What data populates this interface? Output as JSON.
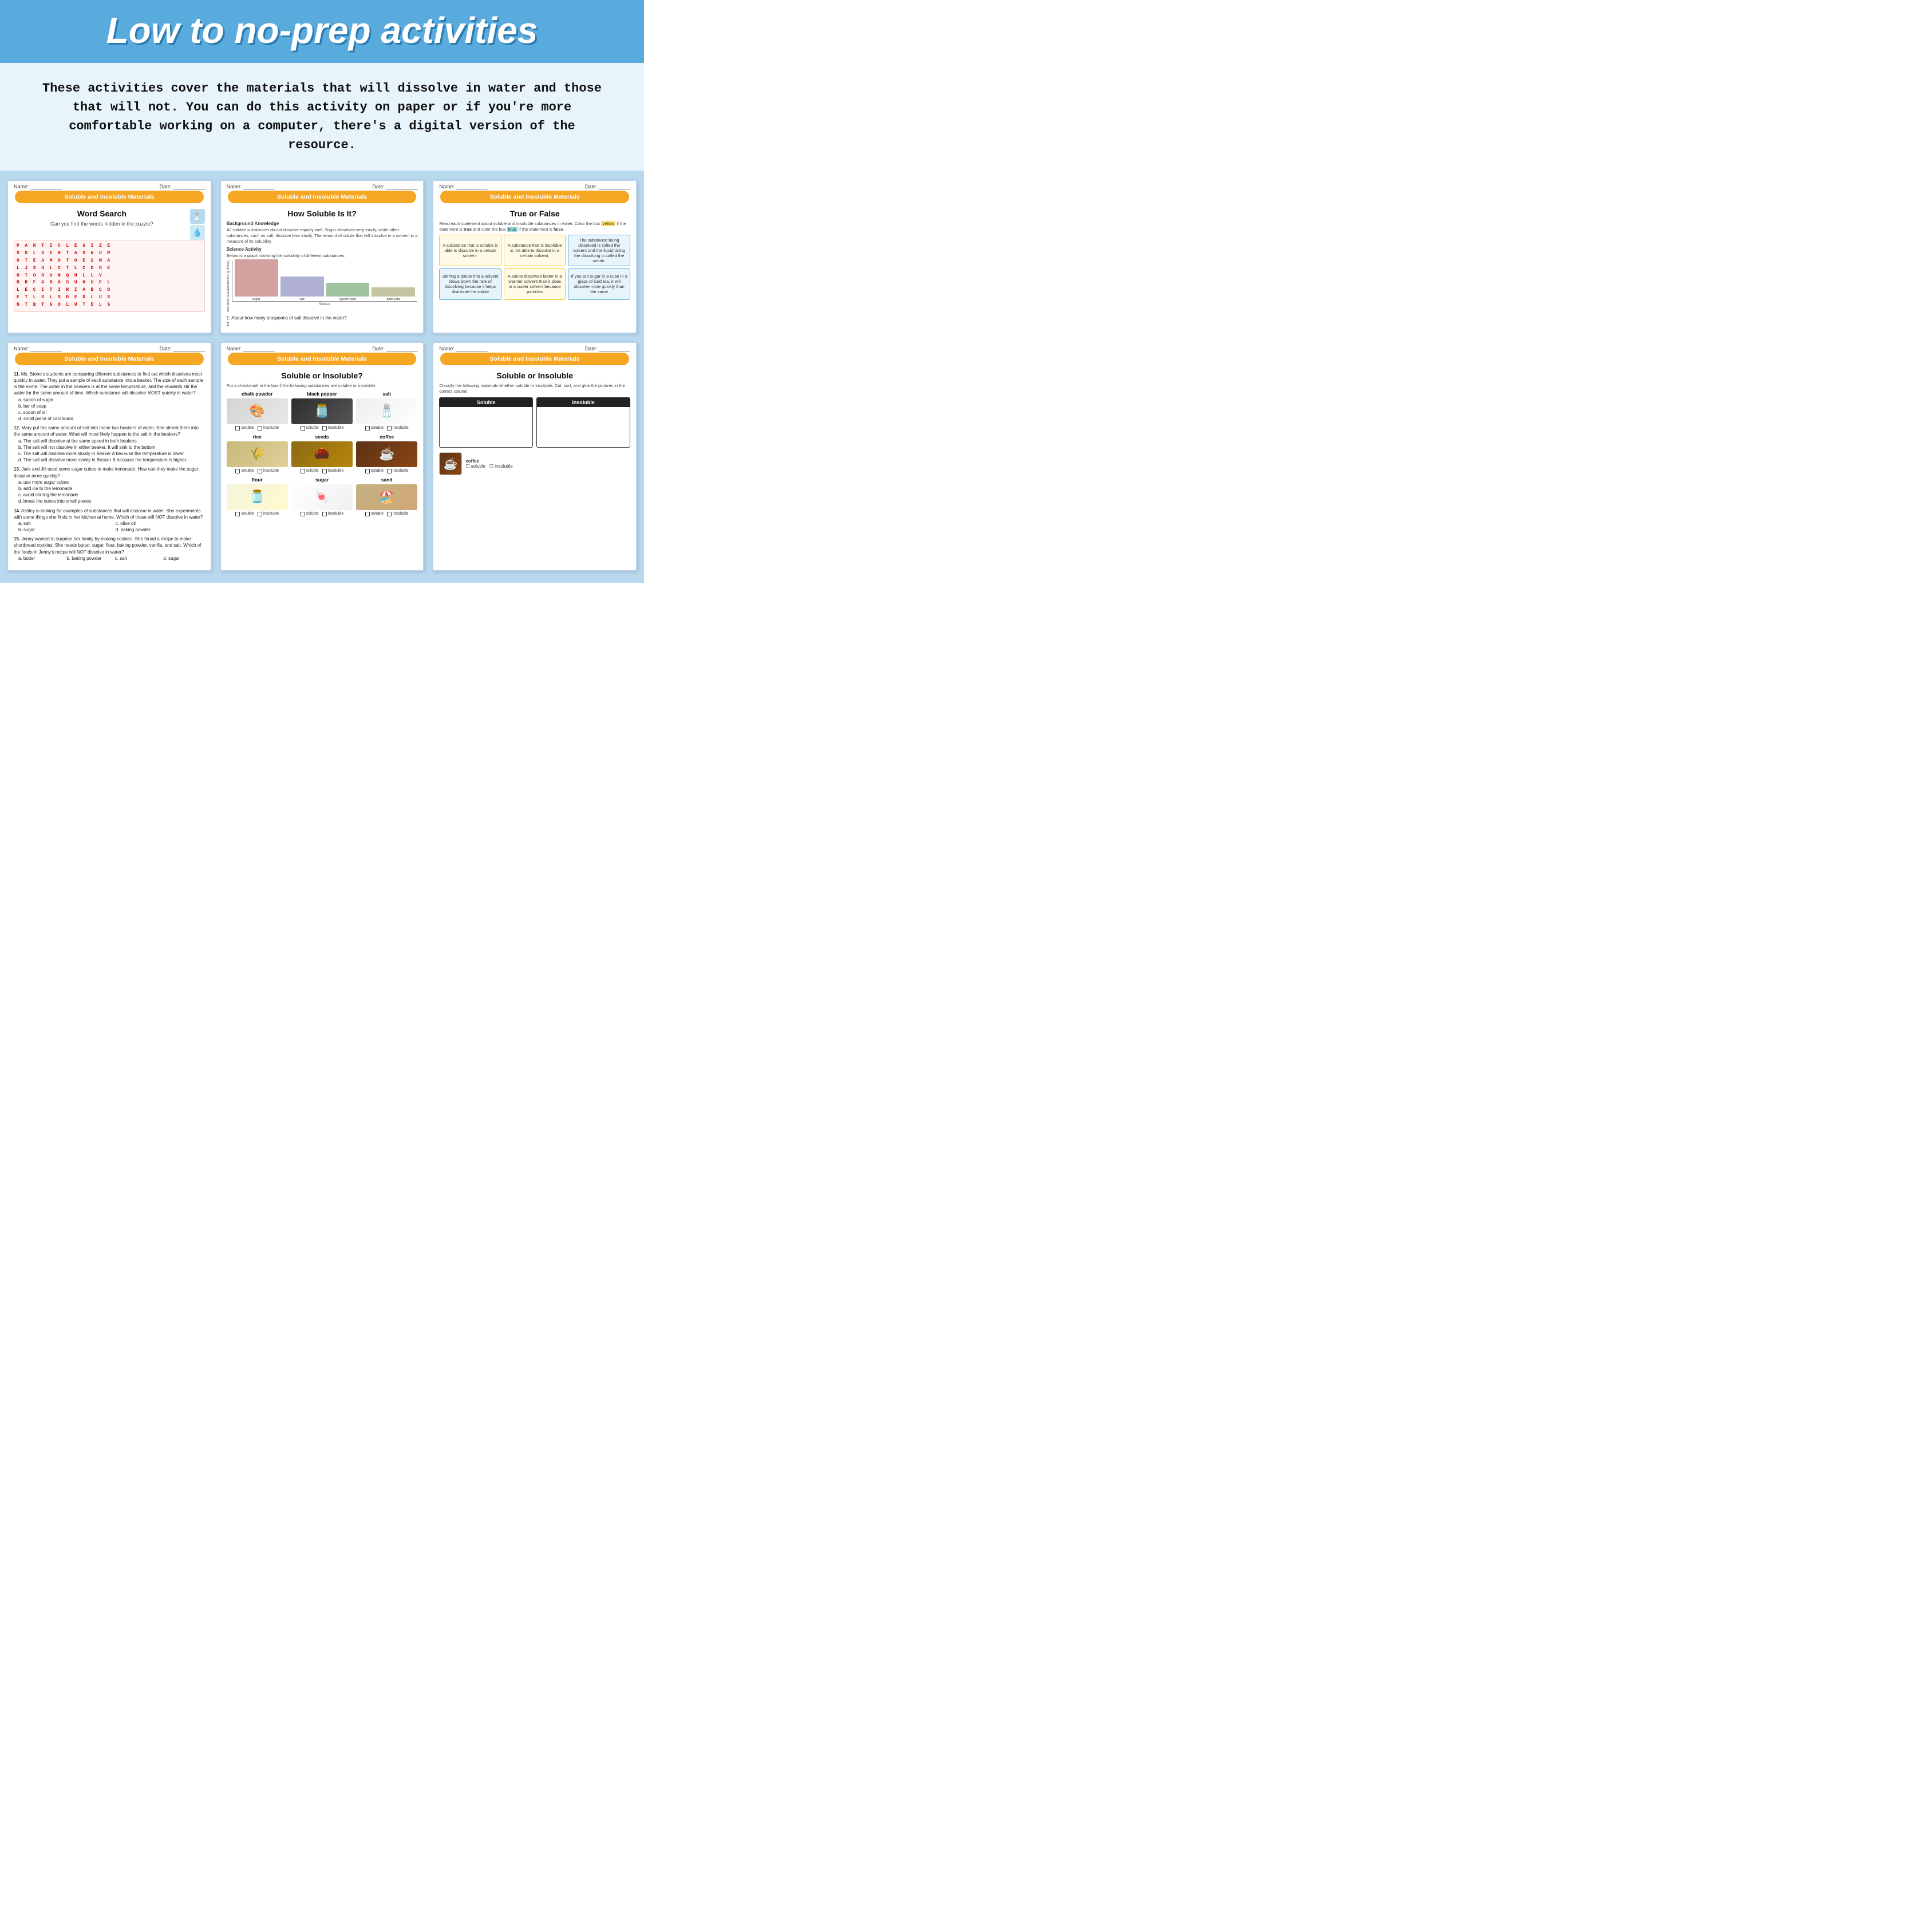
{
  "header": {
    "title": "Low to no-prep activities",
    "bg_color": "#5aabdd"
  },
  "description": {
    "text": "These activities cover the materials that will dissolve in water and those that will not. You can do this activity on paper or if you're more comfortable working on a computer, there's a digital version of the resource."
  },
  "badge_label": "Soluble and Insoluble Materials",
  "cards": [
    {
      "id": "word-search",
      "meta_name": "Name: ___________",
      "meta_date": "Date: ___________",
      "title": "Word Search",
      "subtitle": "Can you find the words hidden in the puzzle?",
      "letters": [
        [
          "P",
          "A",
          "R",
          "T",
          "I",
          "C",
          "L",
          "E",
          "S",
          "I",
          "Z",
          "E",
          "",
          "",
          "",
          ""
        ],
        [
          "S",
          "O",
          "L",
          "V",
          "E",
          "N",
          "T",
          "A",
          "S",
          "N",
          "U",
          "R",
          "",
          "",
          "",
          ""
        ],
        [
          "O",
          "T",
          "E",
          "A",
          "M",
          "O",
          "T",
          "O",
          "E",
          "S",
          "M",
          "A",
          "",
          "",
          "",
          ""
        ],
        [
          "L",
          "J",
          "S",
          "U",
          "L",
          "C",
          "T",
          "L",
          "C",
          "D",
          "O",
          "E",
          "",
          "",
          "",
          ""
        ],
        [
          "U",
          "T",
          "O",
          "R",
          "U",
          "N",
          "Q",
          "H",
          "L",
          "L",
          "V",
          "",
          "",
          "",
          "",
          ""
        ],
        [
          "B",
          "R",
          "F",
          "A",
          "B",
          "A",
          "S",
          "U",
          "H",
          "U",
          "E",
          "L",
          "",
          "",
          "",
          ""
        ],
        [
          "L",
          "E",
          "C",
          "I",
          "T",
          "I",
          "R",
          "I",
          "A",
          "B",
          "C",
          "O",
          "",
          "",
          "",
          ""
        ],
        [
          "E",
          "T",
          "L",
          "S",
          "L",
          "S",
          "D",
          "E",
          "D",
          "L",
          "U",
          "S",
          "",
          "",
          "",
          ""
        ],
        [
          "N",
          "T",
          "B",
          "T",
          "S",
          "O",
          "L",
          "U",
          "T",
          "E",
          "L",
          "S",
          "",
          "",
          "",
          ""
        ]
      ],
      "corner_icons": [
        "🧂",
        "💧"
      ]
    },
    {
      "id": "how-soluble",
      "meta_name": "Name: ___________",
      "meta_date": "Date: ___________",
      "title": "How Soluble Is It?",
      "bg_label": "Background Knowledge",
      "bg_text": "All soluble substances do not dissolve equally well. Sugar dissolves very easily, while other substances, such as salt, dissolve less easily. The amount of solute that will dissolve in a solvent is a measure of its solubility.",
      "science_label": "Science Activity",
      "science_text": "Below is a graph showing the solubility of different substances.",
      "chart": {
        "y_label": "Solubility (teaspoons/100 g water)",
        "bars": [
          {
            "label": "sugar",
            "height": 95,
            "color": "#d4a0a0"
          },
          {
            "label": "salt",
            "height": 45,
            "color": "#b0b0d4"
          },
          {
            "label": "Epsom salts",
            "height": 30,
            "color": "#a0c4a0"
          },
          {
            "label": "bath salts",
            "height": 20,
            "color": "#c4c4a0"
          }
        ],
        "x_label": "Solutes"
      },
      "question": "1. About how many teaspoons of salt dissolve in the water?"
    },
    {
      "id": "true-false",
      "meta_name": "Name: ___________",
      "meta_date": "Date: ___________",
      "title": "True or False",
      "instruction": "Read each statement about soluble and insoluble substances in water. Color the box yellow if the statement is true and color the box blue if the statement is false.",
      "boxes": [
        {
          "text": "A substance that is soluble is able to dissolve in a certain solvent.",
          "type": "yellow"
        },
        {
          "text": "A substance that is insoluble is not able to dissolve in a certain solvent.",
          "type": "yellow"
        },
        {
          "text": "The substance being dissolved is called the solvent and the liquid doing the dissolving is called the solute.",
          "type": "blue"
        },
        {
          "text": "Stirring a solute into a solvent slows down the rate of dissolving because it helps distribute the solute",
          "type": "blue"
        },
        {
          "text": "A solute dissolves faster in a warmer solvent than it does in a cooler solvent because particles",
          "type": "yellow"
        },
        {
          "text": "If you put sugar in a cube in a glass of iced tea, it will dissolve more quickly than the same",
          "type": "blue"
        }
      ]
    },
    {
      "id": "mcq",
      "meta_name": "Name: ___________",
      "meta_date": "Date: ___________",
      "questions": [
        {
          "num": "11.",
          "text": "Ms. Stone's students are comparing different substances to find out which dissolves most quickly in water. They put a sample of each substance into a beaker. The size of each sample is the same. The water in the beakers is at the same temperature, and the students stir the water for the same amount of time. Which substance will dissolve MOST quickly in water?",
          "options": [
            "a. spoon of sugar",
            "b. bar of soap",
            "c. spoon of oil",
            "d. small piece of cardboard"
          ]
        },
        {
          "num": "12.",
          "text": "Mary put the same amount of salt into these two beakers of water. She stirred them into the same amount of water. What will most likely happen to the salt in the beakers?",
          "options": [
            "a. The salt will dissolve at the same speed in both beakers.",
            "b. The salt will not dissolve in either beaker. It will sink to the bottom",
            "c. The salt will dissolve more slowly in Beaker A because the temperature is lower.",
            "d. The salt will dissolve more slowly in Beaker B because the temperature is higher."
          ]
        },
        {
          "num": "13.",
          "text": "Jack and Jill used some sugar cubes to make lemonade. How can they make the sugar dissolve more quickly?",
          "options": [
            "a. use more sugar cubes",
            "b. add ice to the lemonade",
            "c. avoid stirring the lemonade",
            "d. break the cubes into small pieces"
          ]
        },
        {
          "num": "14.",
          "text": "Ashley is looking for examples of substances that will dissolve in water. She experiments with some things she finds in her kitchen at home. Which of these will NOT dissolve in water?",
          "options": [
            "a. salt",
            "b. sugar",
            "c. olive oil",
            "d. baking powder"
          ]
        },
        {
          "num": "15.",
          "text": "Jenny wanted to surprise her family by making cookies. She found a recipe to make shortbread cookies. She needs butter, sugar, flour, baking powder, vanilla, and salt. Which of the foods in Jenny's recipe will NOT dissolve in water?",
          "options": [
            "a. butter",
            "b. baking powder",
            "c. salt",
            "d. sugar"
          ]
        }
      ]
    },
    {
      "id": "soluble-checkmark",
      "meta_name": "Name: ___________",
      "meta_date": "Date: ___________",
      "title": "Soluble or Insoluble?",
      "instruction": "Put a checkmark in the box if the following substances are soluble or insoluble.",
      "items": [
        {
          "label": "chalk powder",
          "emoji": "🎨",
          "bg": "img-chalk"
        },
        {
          "label": "black pepper",
          "emoji": "🫙",
          "bg": "img-pepper"
        },
        {
          "label": "salt",
          "emoji": "🧂",
          "bg": "img-salt"
        },
        {
          "label": "rice",
          "emoji": "🌾",
          "bg": "img-rice"
        },
        {
          "label": "seeds",
          "emoji": "🌰",
          "bg": "img-seeds"
        },
        {
          "label": "coffee",
          "emoji": "☕",
          "bg": "img-coffee"
        },
        {
          "label": "flour",
          "emoji": "🫙",
          "bg": "img-flour"
        },
        {
          "label": "sugar",
          "emoji": "🍬",
          "bg": "img-sugar"
        },
        {
          "label": "sand",
          "emoji": "🏖️",
          "bg": "img-sand"
        }
      ]
    },
    {
      "id": "soluble-sort",
      "meta_name": "Name: ___________",
      "meta_date": "Date: ___________",
      "title": "Soluble or Insoluble",
      "instruction": "Classify the following materials whether soluble or insoluble. Cut, sort, and glue the pictures in the correct column.",
      "col1": "Soluble",
      "col2": "Insoluble",
      "note": "coffee soluble insoluble"
    }
  ]
}
